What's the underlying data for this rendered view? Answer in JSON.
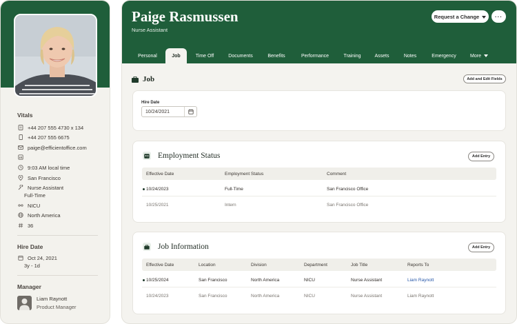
{
  "profile": {
    "vitals_title": "Vitals",
    "vitals": {
      "phone": "+44 207 555 4730 x 134",
      "mobile": "+44 207 555 6675",
      "email": "paige@efficientoffice.com",
      "local_time": "9:03 AM local time",
      "city": "San Francisco",
      "job_title": "Nurse Assistant",
      "employment": "Full-Time",
      "department": "NICU",
      "division": "North America",
      "employee_number": "36"
    },
    "hire_date_title": "Hire Date",
    "hire_date": "Oct 24, 2021",
    "tenure": "3y - 1d",
    "manager_title": "Manager",
    "manager_name": "Liam Raynott",
    "manager_role": "Product Manager"
  },
  "header": {
    "name": "Paige Rasmussen",
    "title": "Nurse Assistant",
    "request_change_label": "Request a Change",
    "more_label": "···"
  },
  "tabs": [
    "Personal",
    "Job",
    "Time Off",
    "Documents",
    "Benefits",
    "Performance",
    "Training",
    "Assets",
    "Notes",
    "Emergency",
    "More"
  ],
  "active_tab": "Job",
  "job": {
    "title": "Job",
    "add_edit_fields_label": "Add and Edit Fields",
    "hire_date_label": "Hire Date",
    "hire_date_value": "10/24/2021"
  },
  "employment_status": {
    "title": "Employment Status",
    "add_entry_label": "Add Entry",
    "columns": [
      "Effective Date",
      "Employment Status",
      "Comment"
    ],
    "rows": [
      {
        "date": "10/24/2023",
        "status": "Full-Time",
        "comment": "San Francisco Office",
        "current": true
      },
      {
        "date": "10/25/2021",
        "status": "Intern",
        "comment": "San Francisco Office",
        "current": false
      }
    ]
  },
  "job_information": {
    "title": "Job Information",
    "add_entry_label": "Add Entry",
    "columns": [
      "Effective Date",
      "Location",
      "Division",
      "Department",
      "Job Title",
      "Reports To"
    ],
    "rows": [
      {
        "date": "10/25/2024",
        "location": "San Francisco",
        "division": "North America",
        "department": "NICU",
        "job_title": "Nurse Assistant",
        "reports_to": "Liam Raynott",
        "current": true
      },
      {
        "date": "10/24/2023",
        "location": "San Francisco",
        "division": "North America",
        "department": "NICU",
        "job_title": "Nurse Assistant",
        "reports_to": "Liam Raynott",
        "current": false
      }
    ]
  },
  "colors": {
    "brand_green": "#1f5e3a",
    "link_blue": "#2556a8",
    "panel_bg": "#f4f3ef"
  }
}
